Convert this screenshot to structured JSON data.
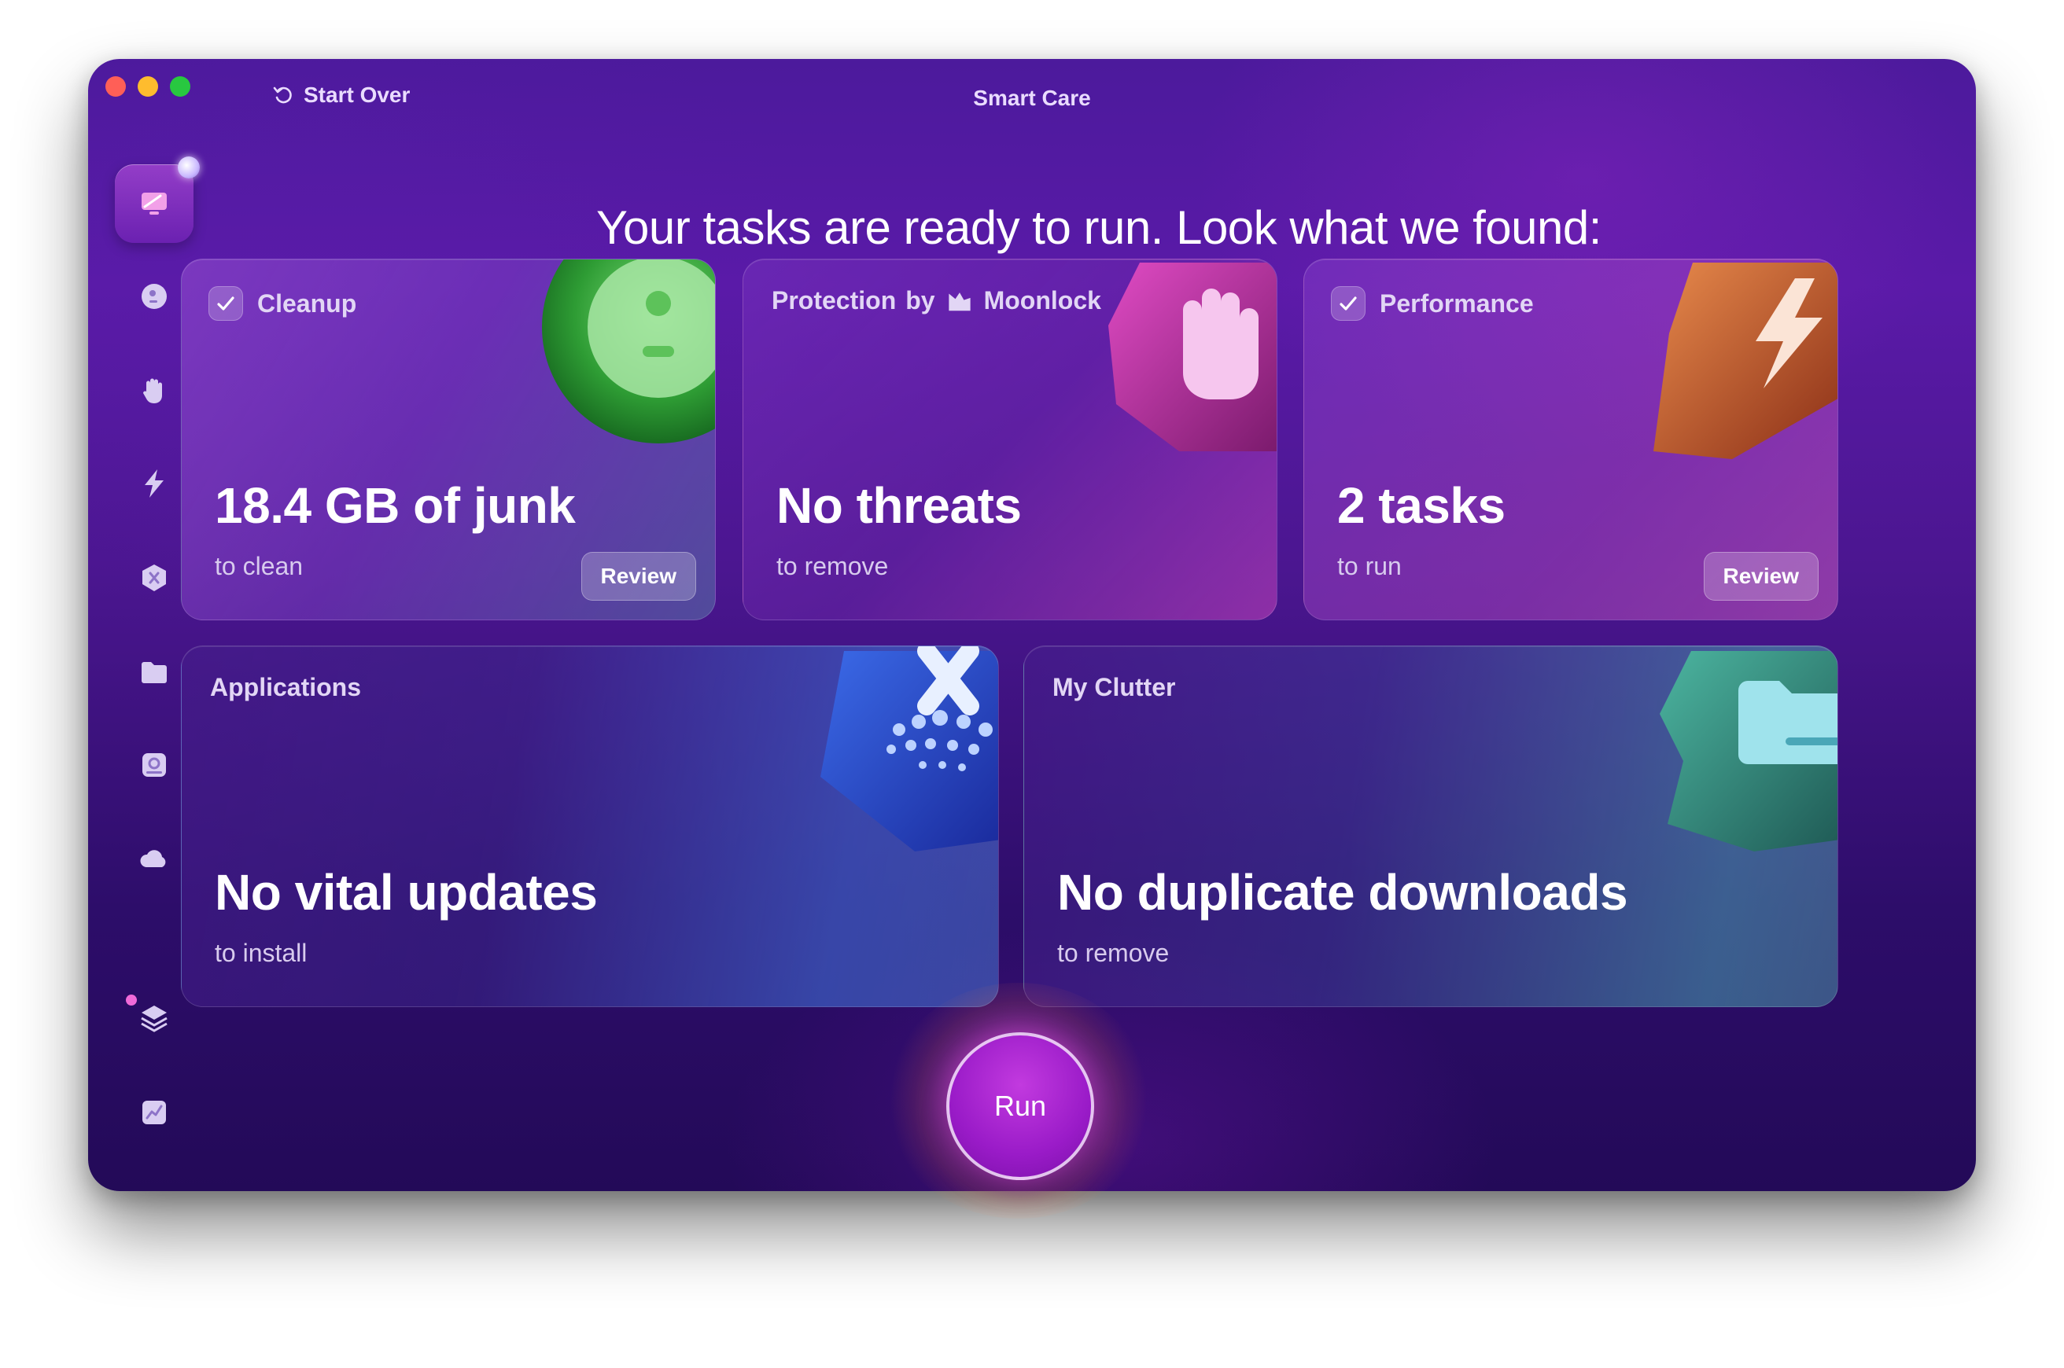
{
  "window": {
    "title": "Smart Care"
  },
  "toolbar": {
    "start_over_label": "Start Over"
  },
  "sidebar": {
    "items": [
      {
        "name": "smart-care",
        "icon": "monitor-icon",
        "active": true
      },
      {
        "name": "cleanup",
        "icon": "cleanup-disc-icon"
      },
      {
        "name": "protection",
        "icon": "hand-icon"
      },
      {
        "name": "performance",
        "icon": "lightning-icon"
      },
      {
        "name": "applications",
        "icon": "apps-icon"
      },
      {
        "name": "my-clutter",
        "icon": "folder-icon"
      },
      {
        "name": "space-lens",
        "icon": "space-lens-icon"
      },
      {
        "name": "cloud",
        "icon": "cloud-icon"
      },
      {
        "name": "assistant",
        "icon": "layers-icon"
      },
      {
        "name": "menu",
        "icon": "chart-icon"
      }
    ]
  },
  "headline": "Your tasks are ready to run. Look what we found:",
  "cards": {
    "cleanup": {
      "title": "Cleanup",
      "value": "18.4 GB of junk",
      "subtitle": "to clean",
      "button": "Review",
      "checked": true
    },
    "protection": {
      "title": "Protection",
      "by": "by",
      "brand": "Moonlock",
      "value": "No threats",
      "subtitle": "to remove"
    },
    "performance": {
      "title": "Performance",
      "value": "2 tasks",
      "subtitle": "to run",
      "button": "Review",
      "checked": true
    },
    "applications": {
      "title": "Applications",
      "value": "No vital updates",
      "subtitle": "to install"
    },
    "clutter": {
      "title": "My Clutter",
      "value": "No duplicate downloads",
      "subtitle": "to remove"
    }
  },
  "run_button": "Run",
  "colors": {
    "accent": "#a020d0",
    "background": "#4c1a9c"
  }
}
